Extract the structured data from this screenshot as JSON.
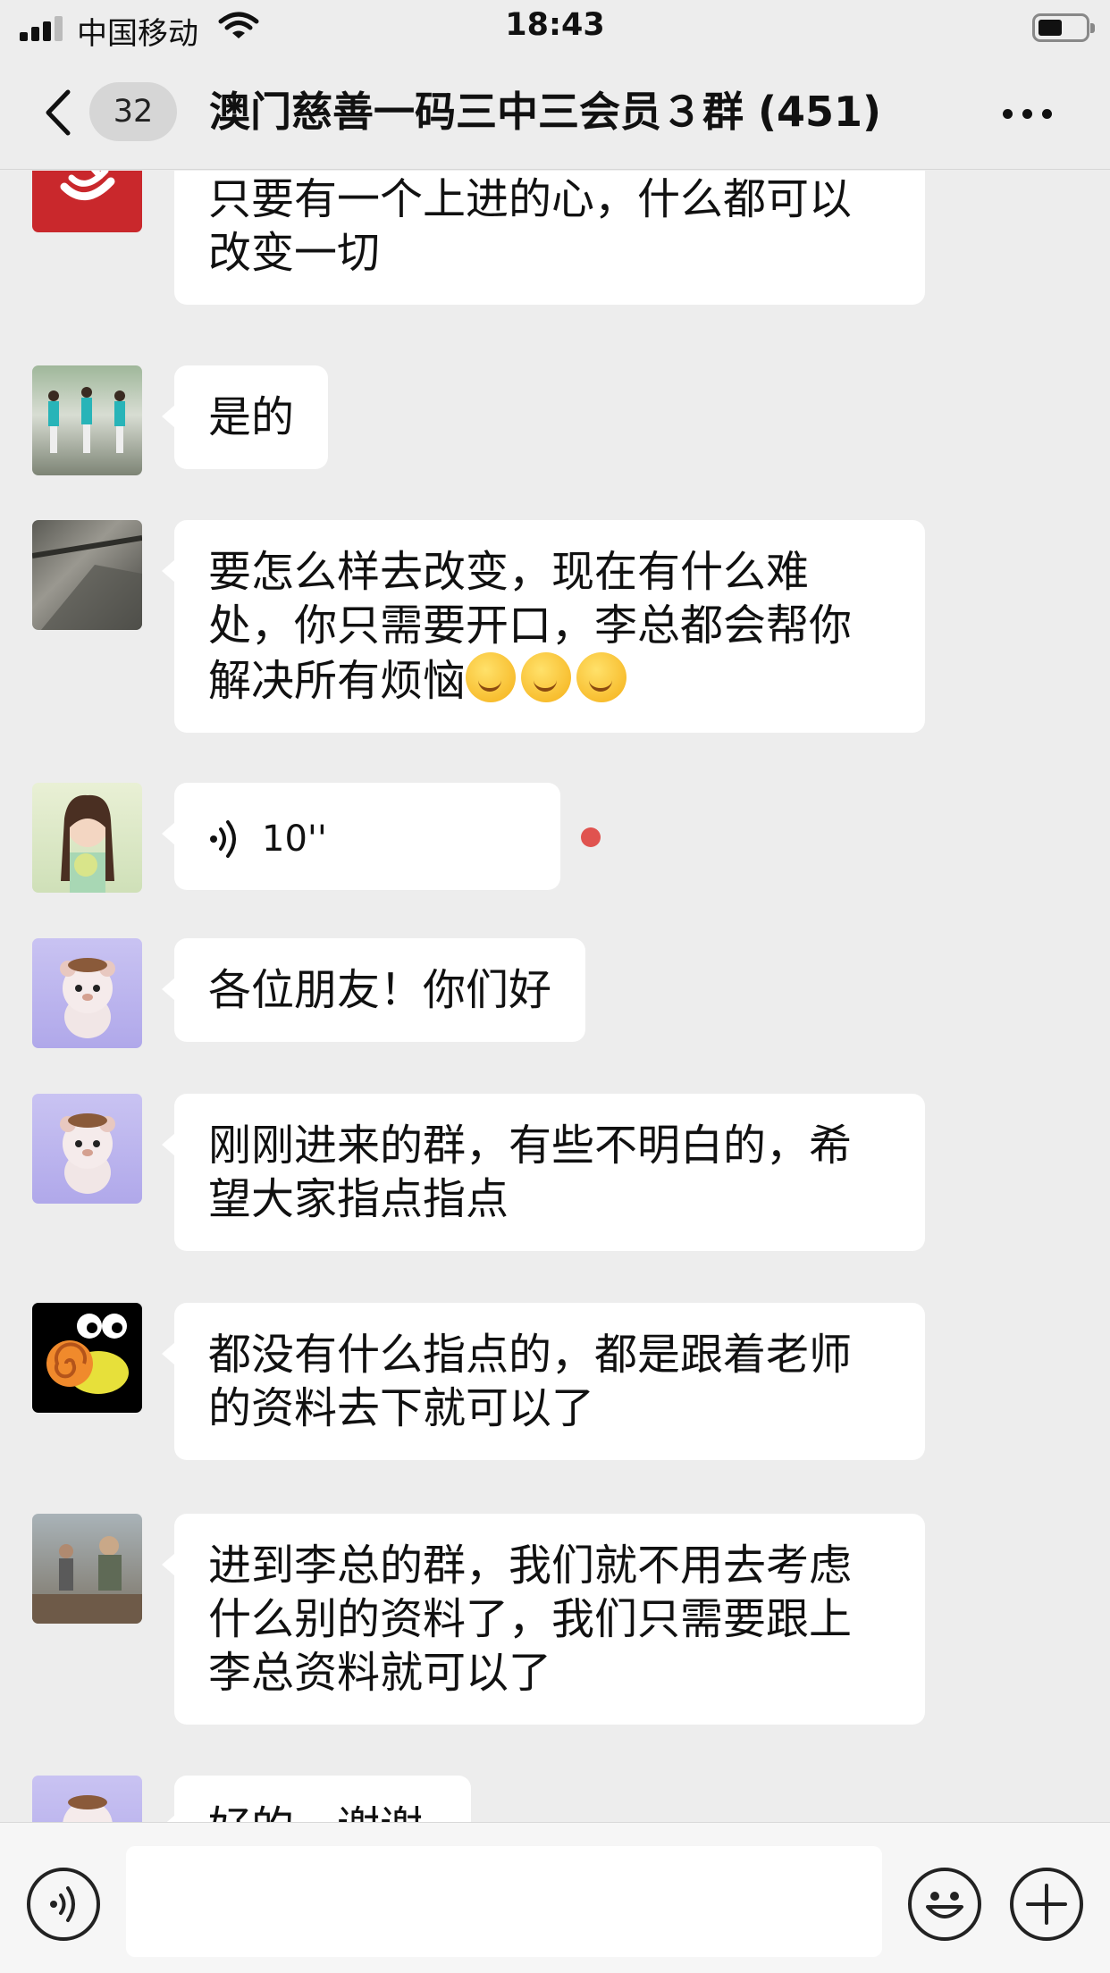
{
  "status_bar": {
    "carrier": "中国移动",
    "time": "18:43"
  },
  "nav": {
    "unread_count": "32",
    "title": "澳门慈善一码三中三会员３群 (451)"
  },
  "messages": [
    {
      "avatar": "red-logo-avatar",
      "text": "只要有一个上进的心，什么都可以改变一切"
    },
    {
      "avatar": "dancers-photo-avatar",
      "text": "是的"
    },
    {
      "avatar": "construction-photo-avatar",
      "text": "要怎么样去改变，现在有什么难处，你只需要开口，李总都会帮你解决所有烦恼"
    },
    {
      "avatar": "girl-photo-avatar",
      "type": "voice",
      "duration": "10''"
    },
    {
      "avatar": "bear-avatar",
      "text": "各位朋友！你们好"
    },
    {
      "avatar": "bear-avatar",
      "text": "刚刚进来的群，有些不明白的，希望大家指点指点"
    },
    {
      "avatar": "snail-avatar",
      "text": "都没有什么指点的，都是跟着老师的资料去下就可以了"
    },
    {
      "avatar": "soldier-photo-avatar",
      "text": "进到李总的群，我们就不用去考虑什么别的资料了，我们只需要跟上李总资料就可以了"
    },
    {
      "avatar": "bear-avatar",
      "text": "好的，谢谢"
    }
  ],
  "emoji_name": "thinking-face-emoji",
  "colors": {
    "background": "#ededed",
    "bubble": "#ffffff",
    "unread_dot": "#e0534f"
  }
}
